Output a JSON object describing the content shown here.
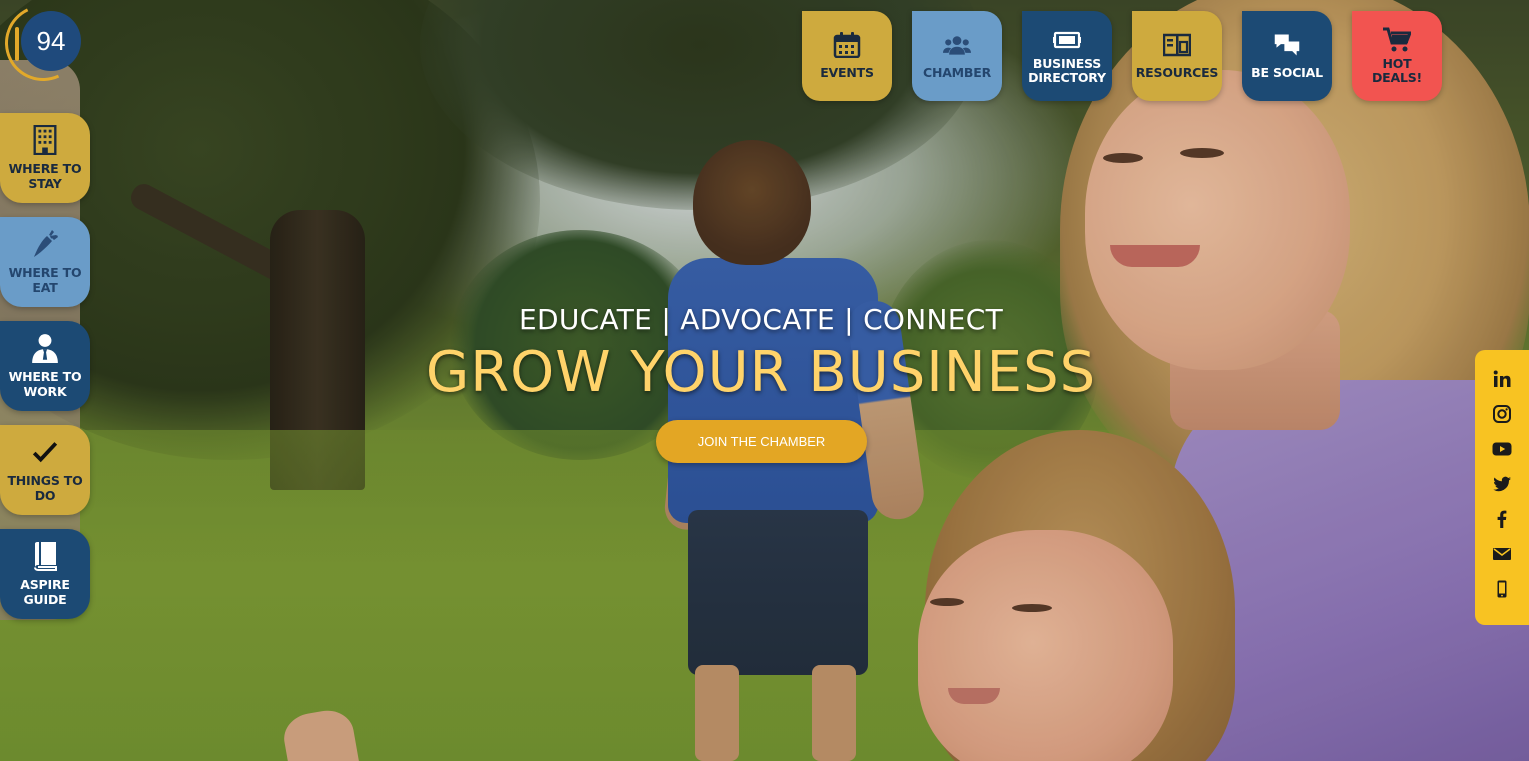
{
  "logo": {
    "text": "94"
  },
  "top_nav": [
    {
      "label": "EVENTS",
      "icon": "calendar-icon",
      "color": "#ceaa3e"
    },
    {
      "label": "CHAMBER",
      "icon": "users-icon",
      "color": "#6a9cc8"
    },
    {
      "label": "BUSINESS\nDIRECTORY",
      "icon": "directory-icon",
      "color": "#1c4a74"
    },
    {
      "label": "RESOURCES",
      "icon": "book-open-icon",
      "color": "#ceaa3e"
    },
    {
      "label": "BE SOCIAL",
      "icon": "chat-bubbles-icon",
      "color": "#1c4a74"
    },
    {
      "label": "HOT\nDEALS!",
      "icon": "cart-icon",
      "color": "#f25450"
    }
  ],
  "side_nav": [
    {
      "label": "WHERE TO\nSTAY",
      "icon": "building-icon",
      "color": "#ceaa3e"
    },
    {
      "label": "WHERE TO\nEAT",
      "icon": "carrot-icon",
      "color": "#6a9cc8"
    },
    {
      "label": "WHERE TO\nWORK",
      "icon": "worker-icon",
      "color": "#1c4a74"
    },
    {
      "label": "THINGS TO\nDO",
      "icon": "checkmark-icon",
      "color": "#ceaa3e"
    },
    {
      "label": "ASPIRE\nGUIDE",
      "icon": "book-icon",
      "color": "#1c4a74"
    }
  ],
  "hero": {
    "tagline": "EDUCATE | ADVOCATE | CONNECT",
    "headline": "GROW YOUR BUSINESS",
    "cta_label": "JOIN THE CHAMBER"
  },
  "social": [
    "linkedin-icon",
    "instagram-icon",
    "youtube-icon",
    "twitter-icon",
    "facebook-icon",
    "email-icon",
    "mobile-icon"
  ],
  "colors": {
    "gold": "#ceaa3e",
    "light_blue": "#6a9cc8",
    "navy": "#1c4a74",
    "red": "#f25450",
    "headline": "#ffd36a",
    "cta": "#e3a624",
    "social_bar": "#f8c322"
  }
}
